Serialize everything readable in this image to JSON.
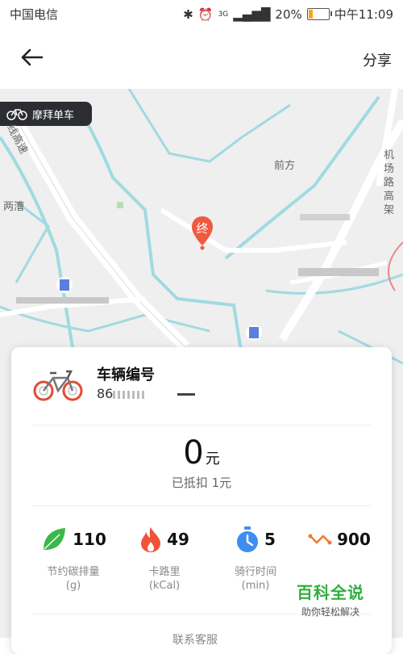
{
  "status_bar": {
    "carrier": "中国电信",
    "network": "3G",
    "battery": "20%",
    "battery_level": 0.2,
    "time": "中午11:09"
  },
  "header": {
    "back_icon": "back-arrow-icon",
    "share_label": "分享"
  },
  "map": {
    "brand_tag": "摩拜单车",
    "labels": [
      "线高速",
      "两漕",
      "前方",
      "机场路高架"
    ],
    "pin_label": "终"
  },
  "card": {
    "vehicle_label": "车辆编号",
    "vehicle_number": "86",
    "amount": "0",
    "amount_unit": "元",
    "deduction": "已抵扣 1元",
    "stats": [
      {
        "icon": "leaf-icon",
        "value": "110",
        "label": "节约碳排量",
        "unit": "(g)",
        "color": "#2fae3e"
      },
      {
        "icon": "flame-icon",
        "value": "49",
        "label": "卡路里",
        "unit": "(kCal)",
        "color": "#f0533a"
      },
      {
        "icon": "stopwatch-icon",
        "value": "5",
        "label": "骑行时间",
        "unit": "(min)",
        "color": "#3d8ef2"
      },
      {
        "icon": "route-icon",
        "value": "900",
        "label": "",
        "unit": "",
        "color": "#f07a30"
      }
    ],
    "contact": "联系客服"
  },
  "watermark": {
    "title": "百科全说",
    "subtitle": "助你轻松解决"
  }
}
